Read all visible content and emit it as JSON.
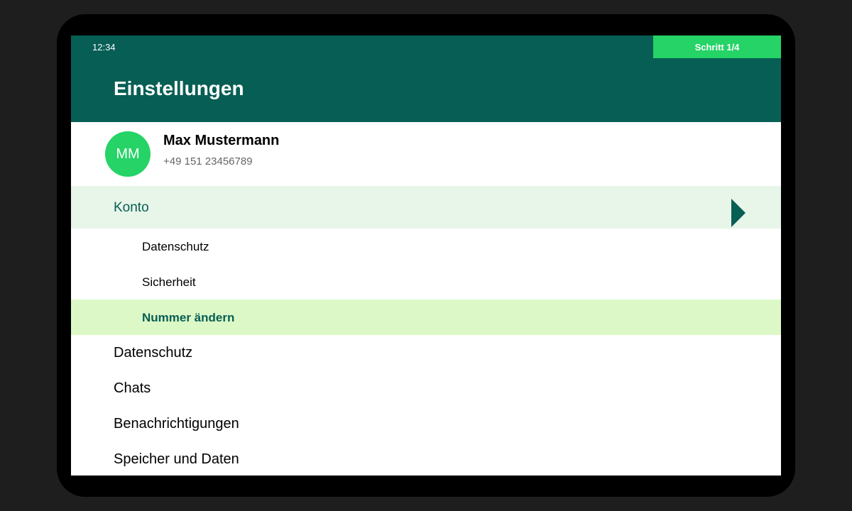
{
  "statusbar": {
    "time": "12:34",
    "step_label": "Schritt 1/4"
  },
  "header": {
    "title": "Einstellungen"
  },
  "profile": {
    "initials": "MM",
    "name": "Max Mustermann",
    "phone": "+49 151 23456789"
  },
  "konto": {
    "label": "Konto",
    "expanded": true,
    "icon": "chevron-right-icon",
    "sub_items": [
      {
        "label": "Datenschutz",
        "selected": false
      },
      {
        "label": "Sicherheit",
        "selected": false
      },
      {
        "label": "Nummer ändern",
        "selected": true
      }
    ]
  },
  "menu_items": [
    {
      "label": "Datenschutz"
    },
    {
      "label": "Chats"
    },
    {
      "label": "Benachrichtigungen"
    },
    {
      "label": "Speicher und Daten"
    }
  ],
  "colors": {
    "primary": "#075e54",
    "accent": "#25d366",
    "konto_highlight": "#e8f5e9",
    "selected_highlight": "#dcf8c6"
  }
}
